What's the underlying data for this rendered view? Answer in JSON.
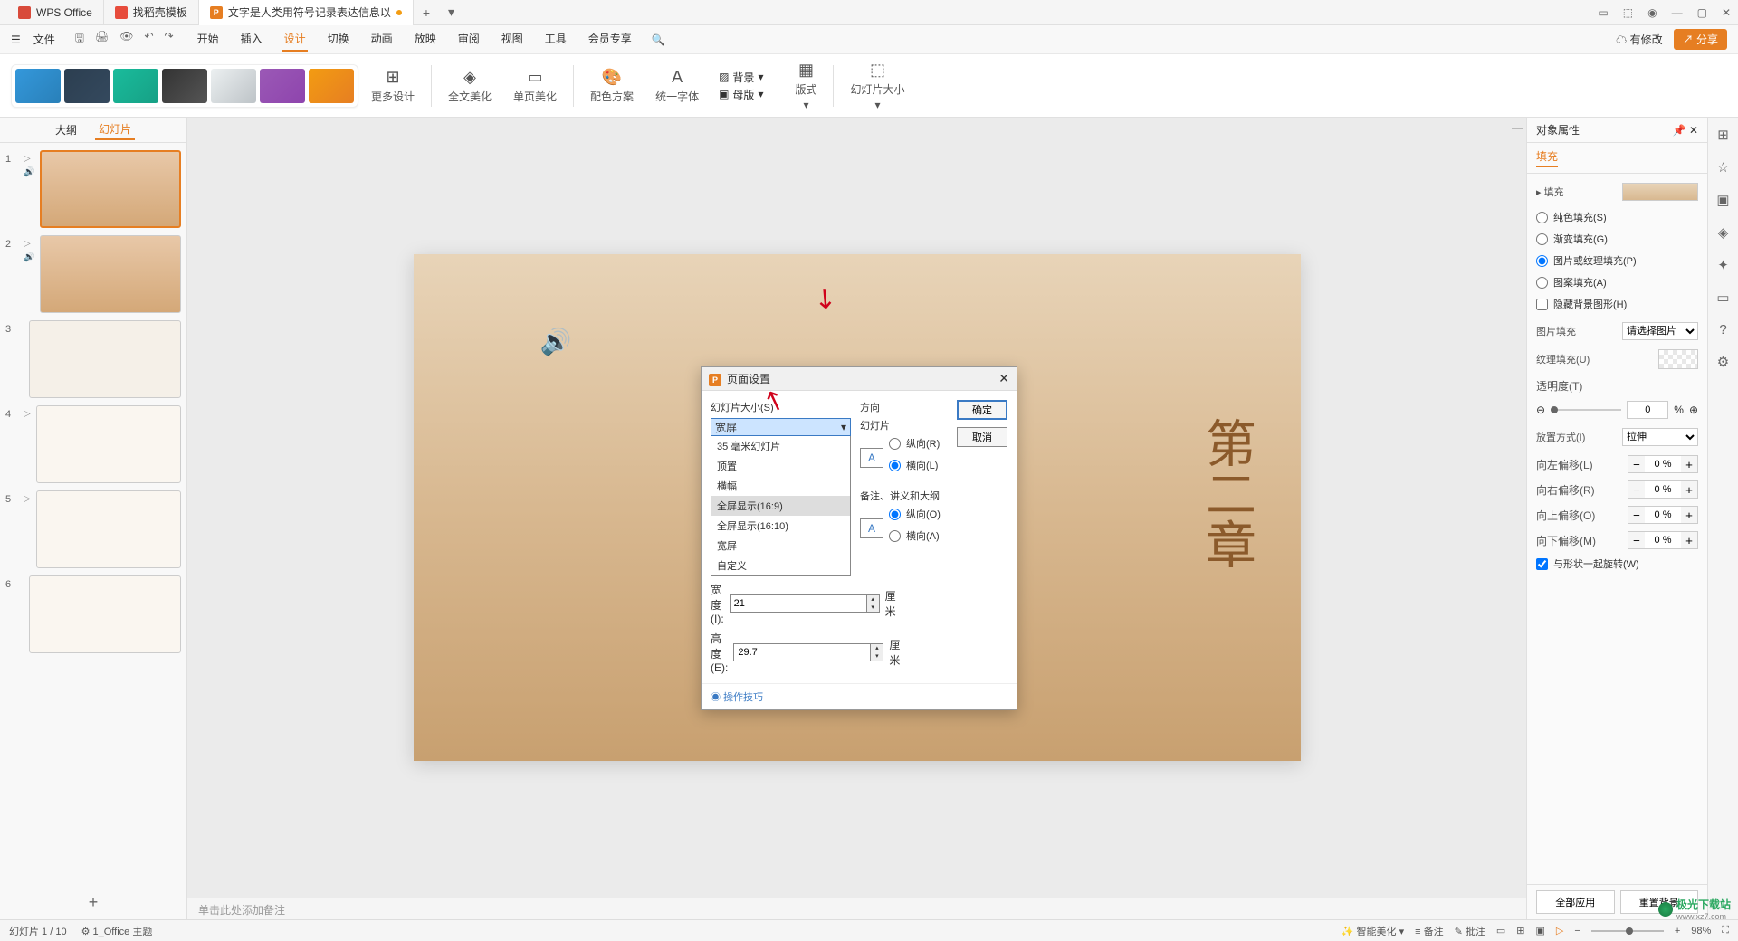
{
  "titlebar": {
    "app": "WPS Office",
    "tab2": "找稻壳模板",
    "tab3": "文字是人类用符号记录表达信息以",
    "plus": "+",
    "dropdown": "▾"
  },
  "menubar": {
    "file": "文件",
    "tabs": [
      "开始",
      "插入",
      "设计",
      "切换",
      "动画",
      "放映",
      "审阅",
      "视图",
      "工具",
      "会员专享"
    ],
    "modified": "有修改",
    "share": "分享"
  },
  "ribbon": {
    "more_design": "更多设计",
    "full_beautify": "全文美化",
    "single_beautify": "单页美化",
    "color_scheme": "配色方案",
    "unify_font": "统一字体",
    "background": "背景",
    "master": "母版",
    "layout": "版式",
    "slide_size": "幻灯片大小"
  },
  "left": {
    "tab_outline": "大纲",
    "tab_slides": "幻灯片"
  },
  "slide": {
    "chapter": "第二章"
  },
  "notes_placeholder": "单击此处添加备注",
  "dialog": {
    "title": "页面设置",
    "slide_size_label": "幻灯片大小(S)",
    "selected": "宽屏",
    "options": [
      "35 毫米幻灯片",
      "顶置",
      "横幅",
      "全屏显示(16:9)",
      "全屏显示(16:10)",
      "宽屏",
      "自定义"
    ],
    "width_label": "宽度(I):",
    "width_val": "21",
    "height_label": "高度(E):",
    "height_val": "29.7",
    "unit": "厘米",
    "orient_label": "方向",
    "slide_label": "幻灯片",
    "portrait_r": "纵向(R)",
    "landscape_l": "横向(L)",
    "notes_label": "备注、讲义和大纲",
    "portrait_o": "纵向(O)",
    "landscape_a": "横向(A)",
    "ok": "确定",
    "cancel": "取消",
    "tips": "操作技巧"
  },
  "right": {
    "header": "对象属性",
    "tab_fill": "填充",
    "section_fill": "填充",
    "solid": "纯色填充(S)",
    "gradient": "渐变填充(G)",
    "picture": "图片或纹理填充(P)",
    "pattern": "图案填充(A)",
    "hide_bg": "隐藏背景图形(H)",
    "pic_fill": "图片填充",
    "pic_select": "请选择图片",
    "texture_fill": "纹理填充(U)",
    "transparency": "透明度(T)",
    "trans_val": "0",
    "percent": "%",
    "tile_mode": "放置方式(I)",
    "tile_val": "拉伸",
    "offset_left": "向左偏移(L)",
    "offset_right": "向右偏移(R)",
    "offset_top": "向上偏移(O)",
    "offset_bottom": "向下偏移(M)",
    "offset_val": "0 %",
    "rotate_with": "与形状一起旋转(W)",
    "apply_all": "全部应用",
    "reset_bg": "重置背景"
  },
  "status": {
    "page": "幻灯片 1 / 10",
    "theme": "1_Office 主题",
    "smart": "智能美化",
    "notes": "备注",
    "comments": "批注",
    "zoom": "98%"
  },
  "watermark": {
    "name": "极光下载站",
    "url": "www.xz7.com"
  }
}
